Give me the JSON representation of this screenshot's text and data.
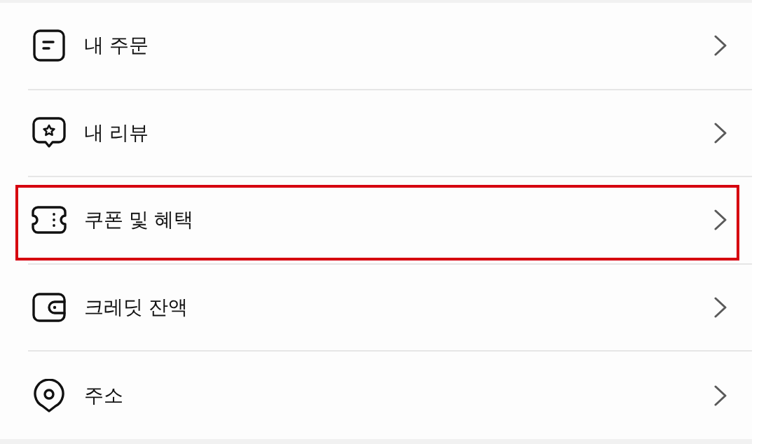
{
  "menu": {
    "items": [
      {
        "kind": "orders",
        "label": "내 주문",
        "highlighted": false
      },
      {
        "kind": "reviews",
        "label": "내 리뷰",
        "highlighted": false
      },
      {
        "kind": "coupons",
        "label": "쿠폰 및 혜택",
        "highlighted": true
      },
      {
        "kind": "credit",
        "label": "크레딧 잔액",
        "highlighted": false
      },
      {
        "kind": "address",
        "label": "주소",
        "highlighted": false
      }
    ]
  }
}
